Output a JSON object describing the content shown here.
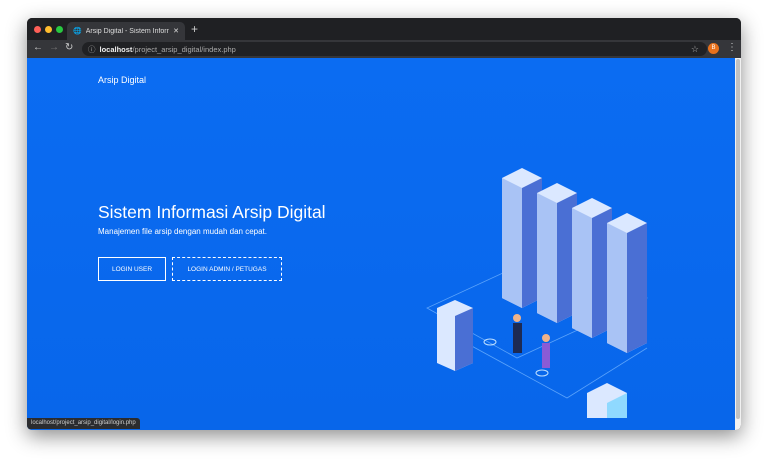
{
  "browser": {
    "tab_title": "Arsip Digital - Sistem Informasi A",
    "url_host": "localhost",
    "url_path": "/project_arsip_digital/index.php",
    "profile_initial": "B",
    "status_url": "localhost/project_arsip_digital/login.php"
  },
  "page": {
    "brand": "Arsip Digital",
    "title": "Sistem Informasi Arsip Digital",
    "subtitle": "Manajemen file arsip dengan mudah dan cepat.",
    "login_user": "LOGIN USER",
    "login_admin": "LOGIN ADMIN / PETUGAS"
  },
  "colors": {
    "background": "#0a6cf0"
  }
}
